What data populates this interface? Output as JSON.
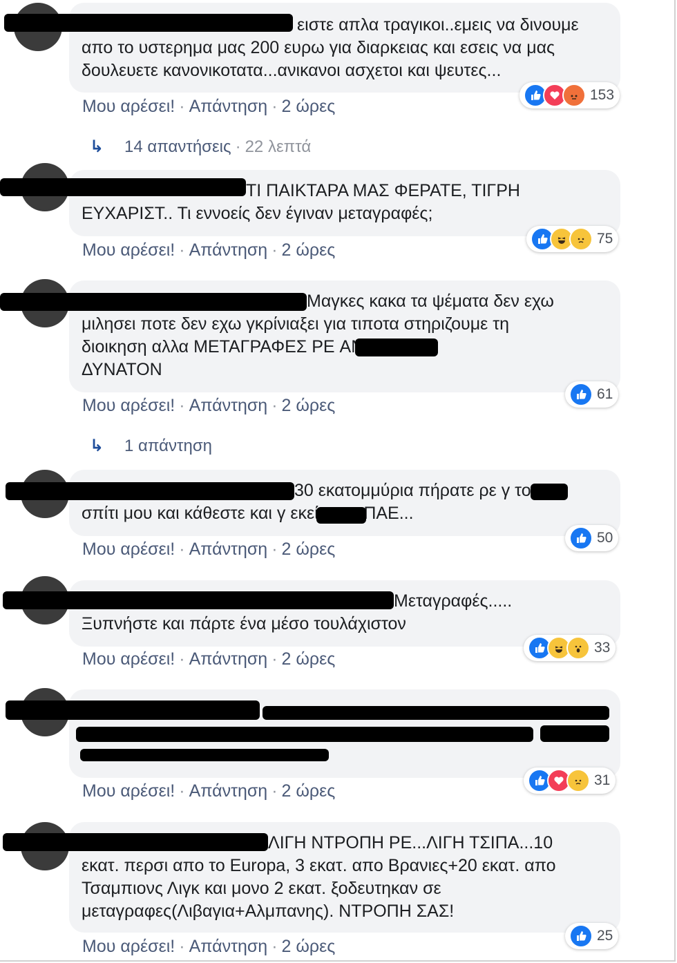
{
  "comments": [
    {
      "text": "ειστε απλα τραγικοι..εμεις να δινουμε\nαπο το υστερημα μας 200 ευρω για διαρκειας και εσεις να μας\nδουλευετε κανονικοτατα...ανικανοι ασχετοι και ψευτες...",
      "like": "Μου αρέσει!",
      "reply": "Απάντηση",
      "time": "2 ώρες",
      "reactions": [
        "like-icon",
        "love-icon",
        "angry-icon"
      ],
      "count": "153"
    },
    {
      "text": "ΤΙ ΠΑΙΚΤΑΡΑ ΜΑΣ ΦΕΡΑΤΕ, ΤΙΓΡΗ\nΕΥΧΑΡΙΣΤ.. Τι εννοείς δεν έγιναν μεταγραφές;",
      "like": "Μου αρέσει!",
      "reply": "Απάντηση",
      "time": "2 ώρες",
      "reactions": [
        "like-icon",
        "haha-icon",
        "sad-icon"
      ],
      "count": "75"
    },
    {
      "text": "Μαγκες κακα τα ψέματα δεν εχω\nμιλησει ποτε δεν εχω γκρίνιαξει για τιποτα στηριζουμε τη\nδιοικηση αλλα ΜΕΤΑΓΡΑΦΕΣ ΡΕ AN ΕΙΝΑΙ\nΔΥΝΑΤΟΝ",
      "like": "Μου αρέσει!",
      "reply": "Απάντηση",
      "time": "2 ώρες",
      "reactions": [
        "like-icon"
      ],
      "count": "61"
    },
    {
      "text": "30 εκατομμύρια πήρατε ρε γ το\nσπίτι μου και κάθεστε και γ εκεί στην ΠΑΕ...",
      "like": "Μου αρέσει!",
      "reply": "Απάντηση",
      "time": "2 ώρες",
      "reactions": [
        "like-icon"
      ],
      "count": "50"
    },
    {
      "text": "Μεταγραφές.....\nΞυπνήστε και πάρτε ένα μέσο τουλάχιστον",
      "like": "Μου αρέσει!",
      "reply": "Απάντηση",
      "time": "2 ώρες",
      "reactions": [
        "like-icon",
        "haha-icon",
        "wow-icon"
      ],
      "count": "33"
    },
    {
      "text": "",
      "like": "Μου αρέσει!",
      "reply": "Απάντηση",
      "time": "2 ώρες",
      "reactions": [
        "like-icon",
        "love-icon",
        "sad-icon"
      ],
      "count": "31"
    },
    {
      "text": "ΛΙΓΗ ΝΤΡΟΠΗ ΡΕ...ΛΙΓΗ ΤΣΙΠΑ...10\nεκατ. περσι απο το Europa, 3 εκατ. απο Βρανιες+20 εκατ. απο\nΤσαμπιονς Λιγκ και μονο 2 εκατ. ξοδευτηκαν σε\nμεταγραφες(Λιβαγια+Αλμπανης). ΝΤΡΟΠΗ ΣΑΣ!",
      "like": "Μου αρέσει!",
      "reply": "Απάντηση",
      "time": "2 ώρες",
      "reactions": [
        "like-icon"
      ],
      "count": "25"
    }
  ],
  "replies": [
    {
      "label": "14 απαντήσεις",
      "time": "22 λεπτά"
    },
    {
      "label": "1 απάντηση",
      "time": ""
    }
  ],
  "separator": "·"
}
